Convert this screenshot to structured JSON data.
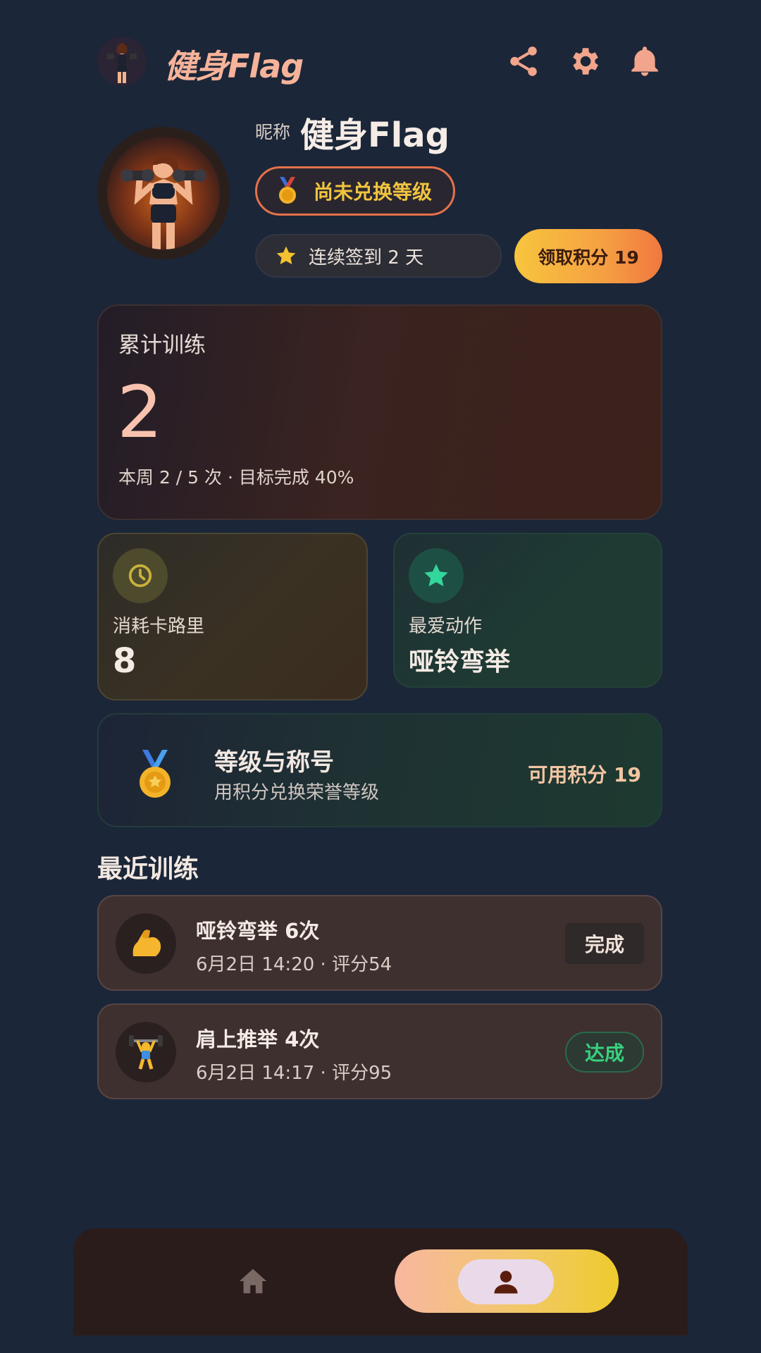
{
  "header": {
    "app_title": "健身Flag"
  },
  "profile": {
    "nick_label": "昵称",
    "nick_name": "健身Flag",
    "level_badge": "尚未兑换等级",
    "checkin_text": "连续签到 2 天",
    "claim_button": "领取积分 19"
  },
  "total": {
    "label": "累计训练",
    "value": "2",
    "sub": "本周 2 / 5 次 · 目标完成 40%"
  },
  "calorie": {
    "label": "消耗卡路里",
    "value": "8"
  },
  "favorite": {
    "label": "最爱动作",
    "value": "哑铃弯举"
  },
  "rank": {
    "title": "等级与称号",
    "desc": "用积分兑换荣誉等级",
    "points": "可用积分 19"
  },
  "recent": {
    "title": "最近训练",
    "records": [
      {
        "emoji": "💪",
        "title": "哑铃弯举 6次",
        "meta": "6月2日 14:20 · 评分54",
        "status": "完成"
      },
      {
        "emoji": "🏋",
        "title": "肩上推举 4次",
        "meta": "6月2日 14:17 · 评分95",
        "status": "达成"
      }
    ]
  },
  "colors": {
    "background": "#1b2638",
    "accent": "#f6b39a",
    "gold": "#f0c43e",
    "success": "#39d07e"
  }
}
